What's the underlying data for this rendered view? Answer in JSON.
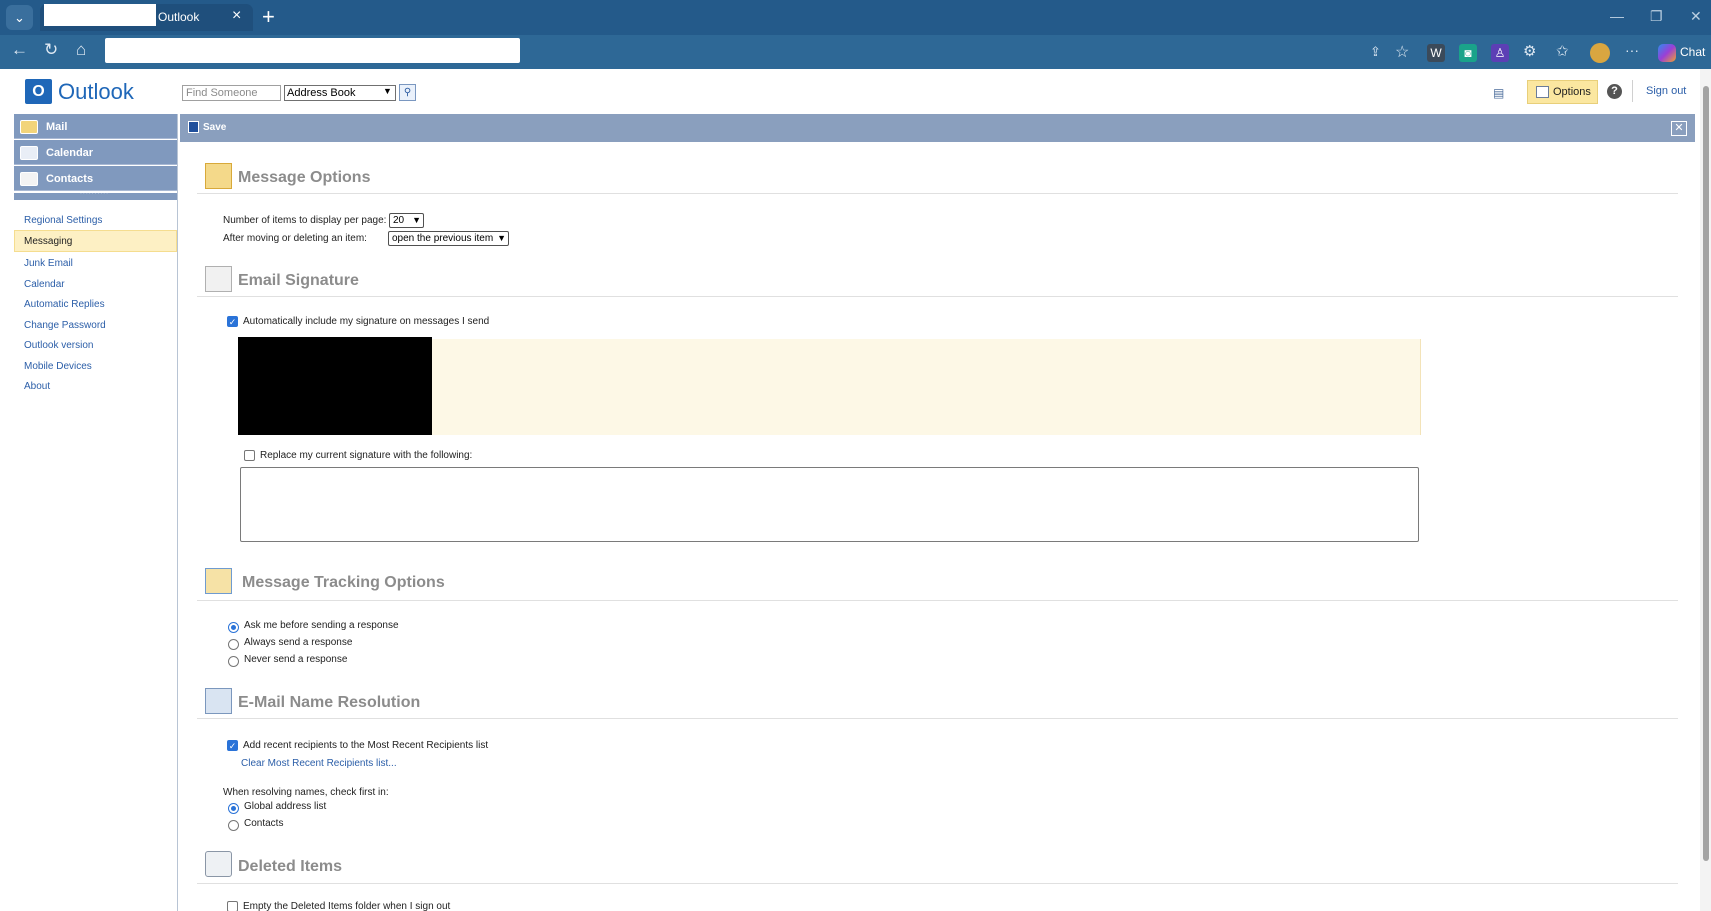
{
  "browser": {
    "tab_title": "Outlook",
    "new_tab": "+",
    "chat_label": "Chat"
  },
  "header": {
    "logo_letter": "O",
    "logo_text": "Outlook",
    "find_placeholder": "Find Someone",
    "address_book": "Address Book",
    "options_label": "Options",
    "help": "?",
    "sign_out": "Sign out"
  },
  "sidebar": {
    "modules": [
      "Mail",
      "Calendar",
      "Contacts"
    ],
    "links": [
      "Regional Settings",
      "Messaging",
      "Junk Email",
      "Calendar",
      "Automatic Replies",
      "Change Password",
      "Outlook version",
      "Mobile Devices",
      "About"
    ],
    "selected": "Messaging"
  },
  "toolbar": {
    "save_label": "Save"
  },
  "message_options": {
    "title": "Message Options",
    "items_label": "Number of items to display per page:",
    "items_value": "20",
    "after_move_label": "After moving or deleting an item:",
    "after_move_value": "open the previous item"
  },
  "email_signature": {
    "title": "Email Signature",
    "auto_include": "Automatically include my signature on messages I send",
    "auto_include_checked": true,
    "replace_label": "Replace my current signature with the following:",
    "replace_checked": false
  },
  "tracking": {
    "title": "Message Tracking Options",
    "options": [
      "Ask me before sending a response",
      "Always send a response",
      "Never send a response"
    ],
    "selected": 0
  },
  "name_resolution": {
    "title": "E-Mail Name Resolution",
    "add_recent": "Add recent recipients to the Most Recent Recipients list",
    "add_recent_checked": true,
    "clear_link": "Clear Most Recent Recipients list...",
    "resolve_label": "When resolving names, check first in:",
    "options": [
      "Global address list",
      "Contacts"
    ],
    "selected": 0
  },
  "deleted_items": {
    "title": "Deleted Items",
    "empty_label": "Empty the Deleted Items folder when I sign out"
  },
  "colors": {
    "accent": "#1f67b8",
    "toolbar": "#8a9fbe",
    "nav": "#8099be",
    "selected": "#fdf0c4"
  }
}
